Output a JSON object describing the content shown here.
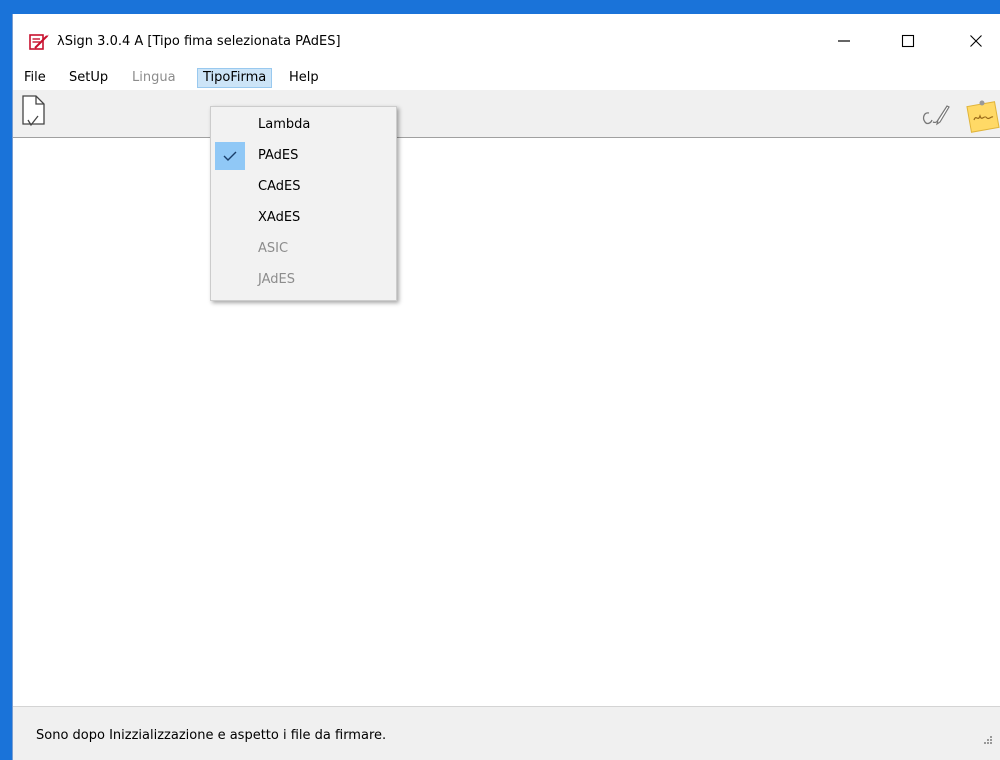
{
  "window": {
    "title": "λSign  3.0.4 A  [Tipo fima selezionata PAdES]"
  },
  "menubar": {
    "items": [
      {
        "label": "File",
        "enabled": true
      },
      {
        "label": "SetUp",
        "enabled": true
      },
      {
        "label": "Lingua",
        "enabled": false
      },
      {
        "label": "TipoFirma",
        "enabled": true,
        "open": true
      },
      {
        "label": "Help",
        "enabled": true
      }
    ]
  },
  "dropdown": {
    "items": [
      {
        "label": "Lambda",
        "checked": false,
        "enabled": true
      },
      {
        "label": "PAdES",
        "checked": true,
        "enabled": true
      },
      {
        "label": "CAdES",
        "checked": false,
        "enabled": true
      },
      {
        "label": "XAdES",
        "checked": false,
        "enabled": true
      },
      {
        "label": "ASIC",
        "checked": false,
        "enabled": false
      },
      {
        "label": "JAdES",
        "checked": false,
        "enabled": false
      }
    ]
  },
  "statusbar": {
    "text": "Sono dopo Inizzializzazione e aspetto i file da firmare."
  },
  "toolbar": {
    "icons": [
      "new-document-icon",
      "signature-pen-icon",
      "sticky-note-icon"
    ]
  },
  "colors": {
    "desktop_accent": "#1a73d9",
    "menu_highlight": "#cce4f7",
    "check_highlight": "#90c8f6",
    "disabled_text": "#8c8c8c"
  }
}
